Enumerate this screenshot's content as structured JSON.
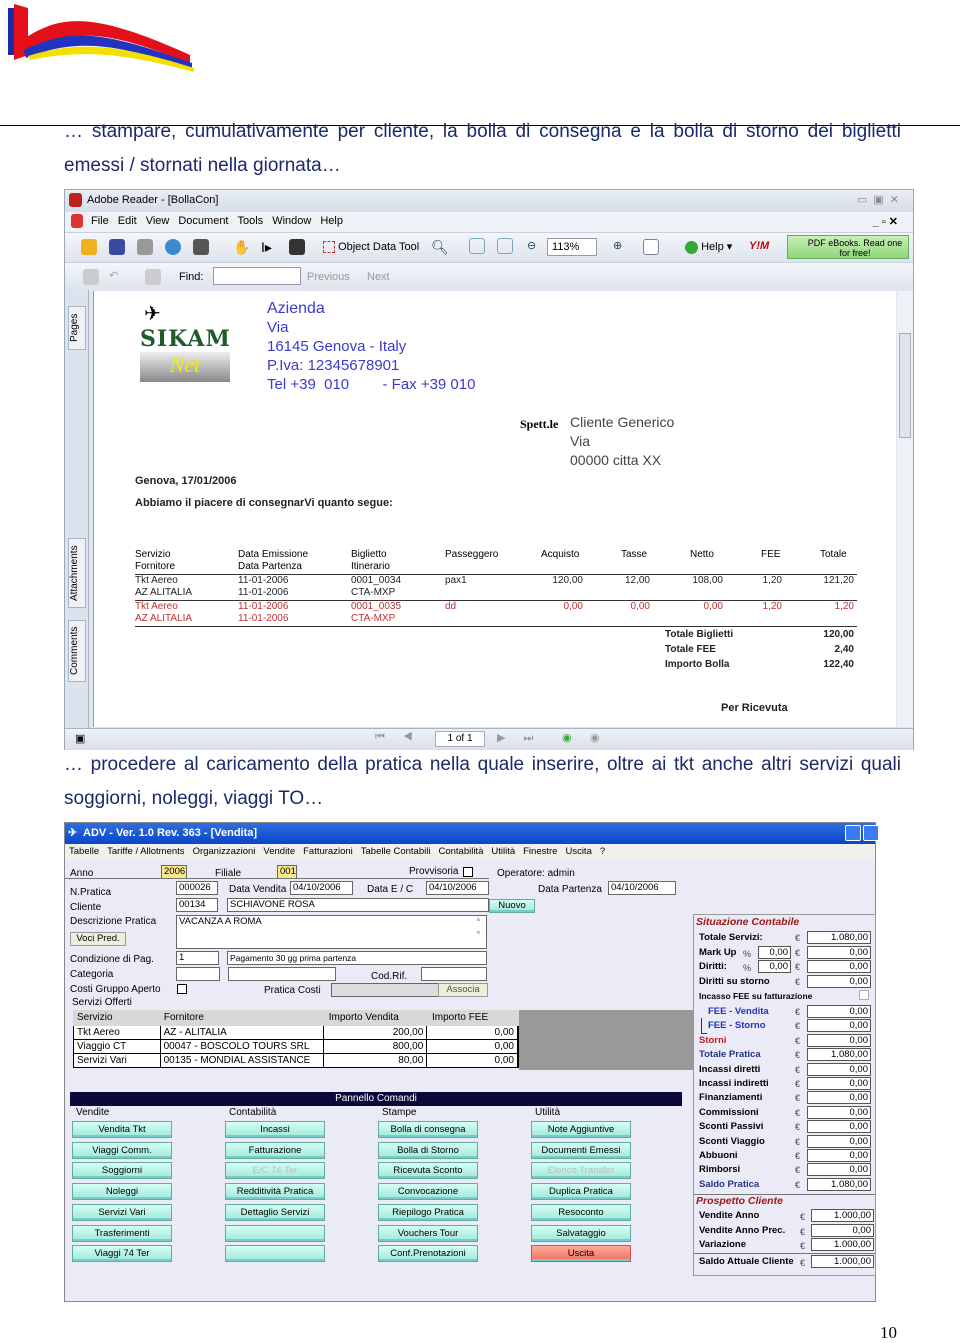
{
  "page": {
    "para1": "… stampare, cumulativamente per cliente, la bolla di consegna e la bolla di storno dei biglietti emessi / stornati nella giornata…",
    "para2": "… procedere al caricamento della pratica nella quale inserire, oltre ai tkt anche altri servizi quali soggiorni, noleggi, viaggi TO…",
    "page_number": "10"
  },
  "adobe": {
    "title": "Adobe Reader - [BollaCon]",
    "menu": [
      "File",
      "Edit",
      "View",
      "Document",
      "Tools",
      "Window",
      "Help"
    ],
    "toolbar": {
      "object_data_tool": "Object Data Tool",
      "zoom": "113%",
      "help": "Help",
      "promo": "PDF eBooks. Read one for free!",
      "find": "Find:",
      "find_value": "",
      "previous": "Previous",
      "next": "Next"
    },
    "side_tabs": [
      "Pages",
      "Attachments",
      "Comments"
    ],
    "page_indicator": "1 of 1",
    "doc": {
      "logo_text": "SIKAM",
      "logo_sub": "Net",
      "company": [
        "Azienda",
        "Via",
        "16145 Genova - Italy",
        "P.Iva: 12345678901",
        "Tel +39  010        - Fax +39 010"
      ],
      "spett": "Spett.le",
      "client": [
        "Cliente Generico",
        "Via",
        "00000 citta XX"
      ],
      "date_line": "Genova, 17/01/2006",
      "intro": "Abbiamo il piacere di consegnarVi quanto segue:",
      "headers": [
        [
          "Servizio",
          "Fornitore"
        ],
        [
          "Data Emissione",
          "Data Partenza"
        ],
        [
          "Biglietto",
          "Itinerario"
        ],
        [
          "Passeggero",
          ""
        ],
        [
          "Acquisto",
          ""
        ],
        [
          "Tasse",
          ""
        ],
        [
          "Netto",
          ""
        ],
        [
          "FEE",
          ""
        ],
        [
          "Totale",
          ""
        ]
      ],
      "rows": [
        {
          "servizio": "Tkt Aereo",
          "fornitore": "AZ ALITALIA",
          "emissione": "11-01-2006",
          "partenza": "11-01-2006",
          "biglietto": "0001_0034",
          "itinerario": "CTA-MXP",
          "passeggero": "pax1",
          "acquisto": "120,00",
          "tasse": "12,00",
          "netto": "108,00",
          "fee": "1,20",
          "totale": "121,20",
          "storno": false
        },
        {
          "servizio": "Tkt Aereo",
          "fornitore": "AZ ALITALIA",
          "emissione": "11-01-2006",
          "partenza": "11-01-2006",
          "biglietto": "0001_0035",
          "itinerario": "CTA-MXP",
          "passeggero": "dd",
          "acquisto": "0,00",
          "tasse": "0,00",
          "netto": "0,00",
          "fee": "1,20",
          "totale": "1,20",
          "storno": true
        }
      ],
      "totals": [
        {
          "label": "Totale Biglietti",
          "value": "120,00"
        },
        {
          "label": "Totale FEE",
          "value": "2,40"
        },
        {
          "label": "Importo Bolla",
          "value": "122,40"
        }
      ],
      "receipt": "Per Ricevuta"
    }
  },
  "adv": {
    "title": "ADV - Ver. 1.0 Rev. 363 - [Vendita]",
    "menu": [
      "Tabelle",
      "Tariffe / Allotments",
      "Organizzazioni",
      "Vendite",
      "Fatturazioni",
      "Tabelle Contabili",
      "Contabilità",
      "Utilità",
      "Finestre",
      "Uscita",
      "?"
    ],
    "form": {
      "anno_label": "Anno",
      "anno": "2006",
      "filiale_label": "Filiale",
      "filiale": "001",
      "provvisoria": "Provvisoria",
      "operatore": "Operatore:  admin",
      "npratica_label": "N.Pratica",
      "npratica": "000026",
      "data_vendita_label": "Data Vendita",
      "data_vendita": "04/10/2006",
      "data_ec_label": "Data E / C",
      "data_ec": "04/10/2006",
      "data_partenza_label": "Data Partenza",
      "data_partenza": "04/10/2006",
      "cliente_label": "Cliente",
      "cliente_code": "00134",
      "cliente_name": "SCHIAVONE ROSA",
      "nuovo": "Nuovo",
      "descr_label": "Descrizione Pratica",
      "descr": "VACANZA A ROMA",
      "voci_pred": "Voci Pred.",
      "cond_label": "Condizione di Pag.",
      "cond_code": "1",
      "cond_text": "Pagamento 30 gg prima partenza",
      "categoria_label": "Categoria",
      "cod_rif": "Cod.Rif.",
      "costi_gruppo": "Costi Gruppo Aperto",
      "pratica_costi": "Pratica Costi",
      "associa": "Associa",
      "servizi_offerti": "Servizi Offerti"
    },
    "services": {
      "headers": [
        "Servizio",
        "Fornitore",
        "Importo Vendita",
        "Importo FEE"
      ],
      "rows": [
        [
          "Tkt Aereo",
          "AZ - ALITALIA",
          "200,00",
          "0,00"
        ],
        [
          "Viaggio CT",
          "00047 - BOSCOLO TOURS SRL",
          "800,00",
          "0,00"
        ],
        [
          "Servizi Vari",
          "00135 - MONDIAL ASSISTANCE",
          "80,00",
          "0,00"
        ]
      ]
    },
    "panel": {
      "title": "Pannello Comandi",
      "columns": [
        {
          "label": "Vendite",
          "buttons": [
            {
              "t": "Vendita Tkt"
            },
            {
              "t": "Viaggi Comm."
            },
            {
              "t": "Soggiorni"
            },
            {
              "t": "Noleggi"
            },
            {
              "t": "Servizi Vari"
            },
            {
              "t": "Trasferimenti"
            },
            {
              "t": "Viaggi 74 Ter"
            }
          ]
        },
        {
          "label": "Contabilità",
          "buttons": [
            {
              "t": "Incassi"
            },
            {
              "t": "Fatturazione"
            },
            {
              "t": "E/C 74 Ter",
              "disabled": true
            },
            {
              "t": "Redditività Pratica"
            },
            {
              "t": "Dettaglio Servizi"
            },
            {
              "t": ""
            },
            {
              "t": ""
            }
          ]
        },
        {
          "label": "Stampe",
          "buttons": [
            {
              "t": "Bolla di consegna"
            },
            {
              "t": "Bolla di Storno"
            },
            {
              "t": "Ricevuta Sconto"
            },
            {
              "t": "Convocazione"
            },
            {
              "t": "Riepilogo Pratica"
            },
            {
              "t": "Vouchers Tour"
            },
            {
              "t": "Conf.Prenotazioni"
            }
          ]
        },
        {
          "label": "Utilità",
          "buttons": [
            {
              "t": "Note Aggiuntive"
            },
            {
              "t": "Documenti Emessi"
            },
            {
              "t": "Elenco Transfer",
              "disabled": true
            },
            {
              "t": "Duplica Pratica"
            },
            {
              "t": "Resoconto"
            },
            {
              "t": "Salvataggio"
            },
            {
              "t": "Uscita",
              "exit": true
            }
          ]
        }
      ]
    },
    "situazione": {
      "title": "Situazione Contabile",
      "currency": "€",
      "incasso_fee": "Incasso FEE su fatturazione",
      "rows": [
        {
          "label": "Totale Servizi:",
          "value": "1.080,00"
        },
        {
          "label": "Mark Up",
          "pct": "0,00",
          "value": "0,00"
        },
        {
          "label": "Diritti:",
          "pct": "0,00",
          "value": "0,00"
        },
        {
          "label": "Diritti su storno",
          "value": "0,00"
        },
        {
          "label": "FEE - Vendita",
          "value": "0,00",
          "color": "#2233bb",
          "indent": true
        },
        {
          "label": "FEE - Storno",
          "value": "0,00",
          "color": "#2233bb",
          "indent": true
        },
        {
          "label": "Storni",
          "value": "0,00",
          "color": "#c02020"
        },
        {
          "label": "Totale Pratica",
          "value": "1.080,00",
          "color": "#223388"
        },
        {
          "label": "Incassi diretti",
          "value": "0,00"
        },
        {
          "label": "Incassi indiretti",
          "value": "0,00"
        },
        {
          "label": "Finanziamenti",
          "value": "0,00"
        },
        {
          "label": "Commissioni",
          "value": "0,00"
        },
        {
          "label": "Sconti Passivi",
          "value": "0,00"
        },
        {
          "label": "Sconti Viaggio",
          "value": "0,00"
        },
        {
          "label": "Abbuoni",
          "value": "0,00"
        },
        {
          "label": "Rimborsi",
          "value": "0,00"
        },
        {
          "label": "Saldo Pratica",
          "value": "1.080,00",
          "color": "#223388"
        }
      ]
    },
    "prospetto": {
      "title": "Prospetto Cliente",
      "rows": [
        {
          "label": "Vendite Anno",
          "value": "1.000,00"
        },
        {
          "label": "Vendite Anno Prec.",
          "value": "0,00"
        },
        {
          "label": "Variazione",
          "value": "1.000,00"
        },
        {
          "label": "Saldo Attuale Cliente",
          "value": "1.000,00"
        }
      ]
    }
  }
}
